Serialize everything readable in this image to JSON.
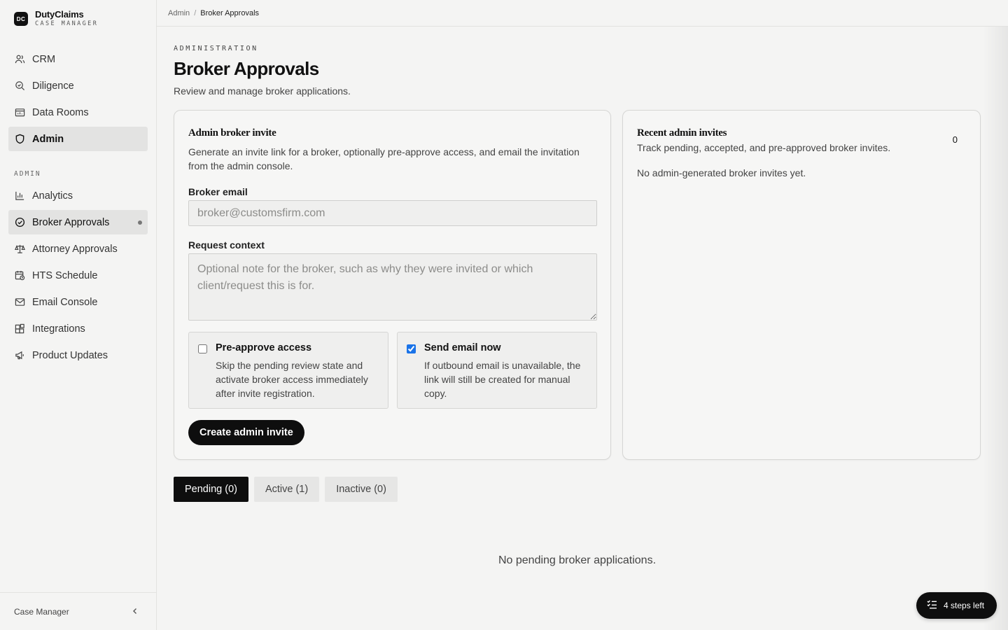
{
  "brand": {
    "logo": "DC",
    "name": "DutyClaims",
    "sub": "CASE MANAGER"
  },
  "sidebar": {
    "primary": [
      {
        "label": "CRM",
        "icon": "users-icon"
      },
      {
        "label": "Diligence",
        "icon": "search-icon"
      },
      {
        "label": "Data Rooms",
        "icon": "folder-icon"
      },
      {
        "label": "Admin",
        "icon": "shield-icon"
      }
    ],
    "section_label": "ADMIN",
    "admin": [
      {
        "label": "Analytics",
        "icon": "bar-chart-icon"
      },
      {
        "label": "Broker Approvals",
        "icon": "check-circle-icon"
      },
      {
        "label": "Attorney Approvals",
        "icon": "scales-icon"
      },
      {
        "label": "HTS Schedule",
        "icon": "calendar-clock-icon"
      },
      {
        "label": "Email Console",
        "icon": "mail-icon"
      },
      {
        "label": "Integrations",
        "icon": "blocks-icon"
      },
      {
        "label": "Product Updates",
        "icon": "megaphone-icon"
      }
    ],
    "footer_label": "Case Manager"
  },
  "breadcrumb": {
    "root": "Admin",
    "sep": "/",
    "current": "Broker Approvals"
  },
  "page": {
    "kicker": "ADMINISTRATION",
    "title": "Broker Approvals",
    "subtitle": "Review and manage broker applications."
  },
  "invite": {
    "title": "Admin broker invite",
    "desc": "Generate an invite link for a broker, optionally pre-approve access, and email the invitation from the admin console.",
    "email_label": "Broker email",
    "email_placeholder": "broker@customsfirm.com",
    "context_label": "Request context",
    "context_placeholder": "Optional note for the broker, such as why they were invited or which client/request this is for.",
    "preapprove": {
      "title": "Pre-approve access",
      "desc": "Skip the pending review state and activate broker access immediately after invite registration.",
      "checked": false
    },
    "send_email": {
      "title": "Send email now",
      "desc": "If outbound email is unavailable, the link will still be created for manual copy.",
      "checked": true
    },
    "submit_label": "Create admin invite"
  },
  "recent": {
    "title": "Recent admin invites",
    "desc": "Track pending, accepted, and pre-approved broker invites.",
    "count": "0",
    "empty": "No admin-generated broker invites yet."
  },
  "tabs": [
    {
      "label": "Pending (0)",
      "active": true
    },
    {
      "label": "Active (1)",
      "active": false
    },
    {
      "label": "Inactive (0)",
      "active": false
    }
  ],
  "empty_applications": "No pending broker applications.",
  "steps_pill": {
    "label": "4 steps left",
    "icon": "checklist-icon"
  },
  "colors": {
    "accent": "#0e0e0e",
    "background": "#f4f4f3",
    "checkbox": "#1a73e8"
  }
}
